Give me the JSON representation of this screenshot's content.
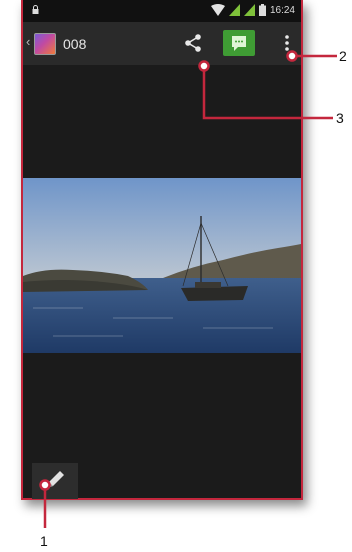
{
  "status_bar": {
    "time": "16:24",
    "icons": [
      "lock-icon",
      "wifi-icon",
      "signal-icon",
      "signal-icon-2",
      "battery-icon"
    ]
  },
  "action_bar": {
    "back_glyph": "‹",
    "title": "008",
    "actions": [
      "share-icon",
      "message-icon",
      "overflow-menu-icon"
    ]
  },
  "bottom_bar": {
    "edit": "pencil-icon"
  },
  "callouts": {
    "c1": "1",
    "c2": "2",
    "c3": "3"
  },
  "colors": {
    "accent": "#c4273d",
    "green": "#3f9c34",
    "screen": "#1b1b1b"
  }
}
